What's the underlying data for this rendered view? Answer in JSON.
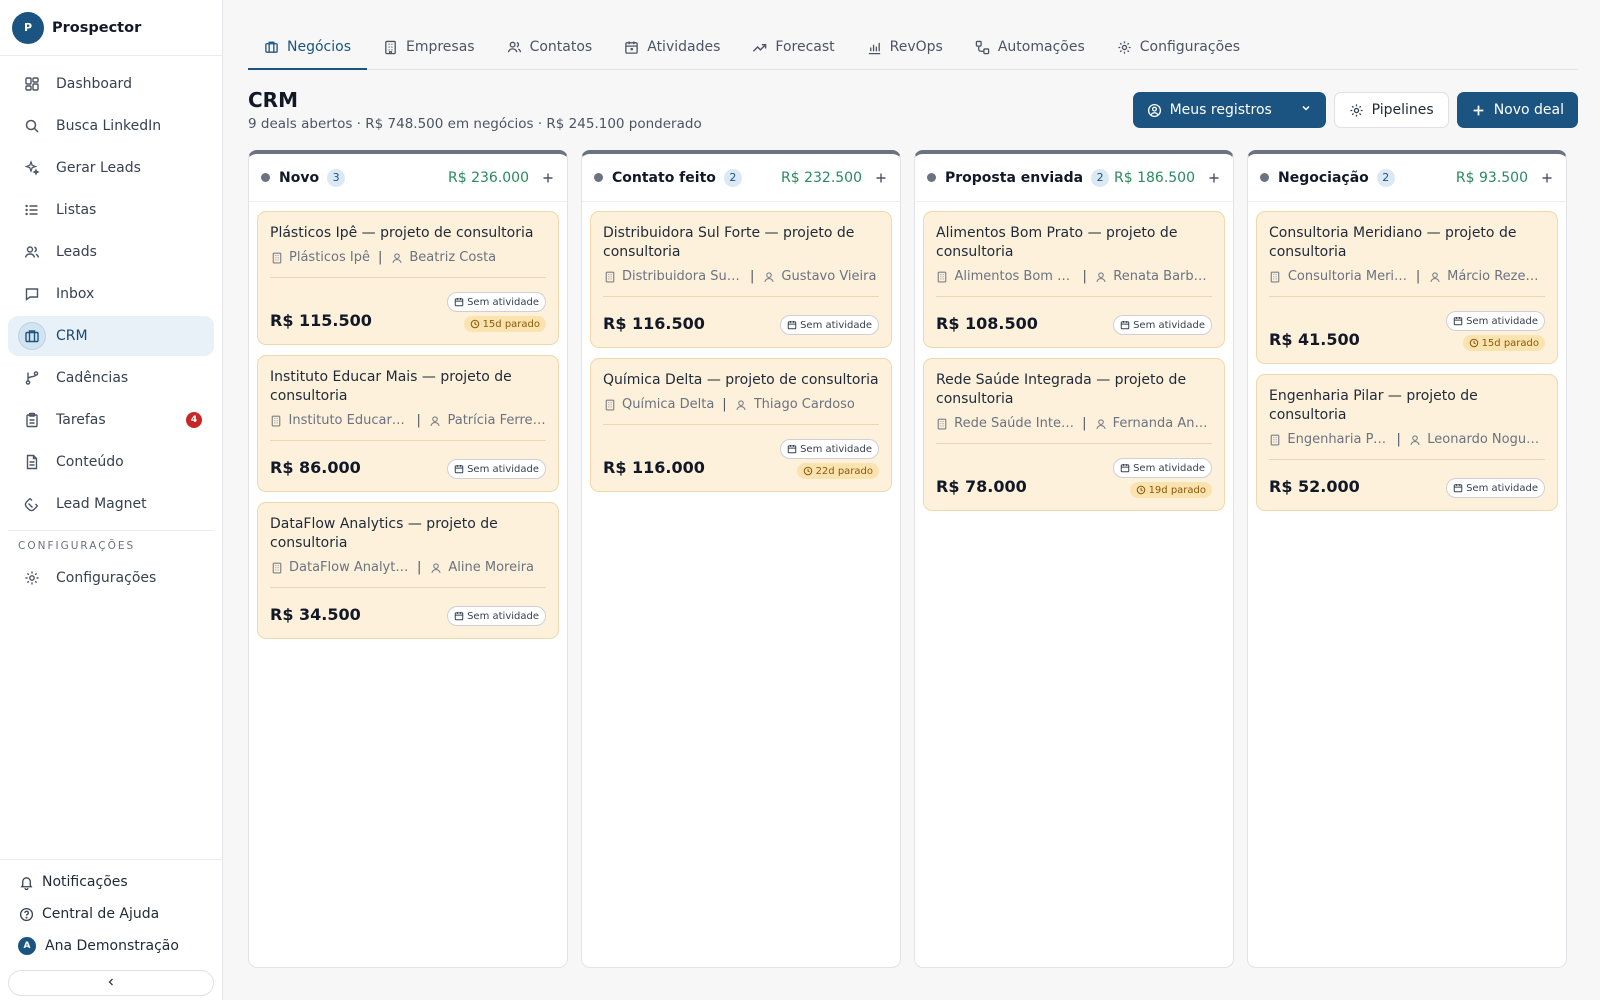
{
  "brand": {
    "logo_letter": "P",
    "name": "Prospector"
  },
  "sidebar": {
    "items": [
      {
        "label": "Dashboard",
        "icon": "dashboard-icon"
      },
      {
        "label": "Busca LinkedIn",
        "icon": "search-icon"
      },
      {
        "label": "Gerar Leads",
        "icon": "sparkles-icon"
      },
      {
        "label": "Listas",
        "icon": "list-icon"
      },
      {
        "label": "Leads",
        "icon": "users-icon"
      },
      {
        "label": "Inbox",
        "icon": "message-icon"
      },
      {
        "label": "CRM",
        "icon": "briefcase-icon",
        "active": true
      },
      {
        "label": "Cadências",
        "icon": "git-branch-icon"
      },
      {
        "label": "Tarefas",
        "icon": "clipboard-icon",
        "badge": "4"
      },
      {
        "label": "Conteúdo",
        "icon": "document-icon"
      },
      {
        "label": "Lead Magnet",
        "icon": "magnet-icon"
      }
    ],
    "section_label": "CONFIGURAÇÕES",
    "settings_label": "Configurações",
    "bottom": {
      "notifications": "Notificações",
      "help": "Central de Ajuda",
      "user_initial": "A",
      "user_name": "Ana Demonstração"
    }
  },
  "tabs": [
    {
      "label": "Negócios",
      "icon": "briefcase-icon",
      "active": true
    },
    {
      "label": "Empresas",
      "icon": "building-icon"
    },
    {
      "label": "Contatos",
      "icon": "users-icon"
    },
    {
      "label": "Atividades",
      "icon": "calendar-icon"
    },
    {
      "label": "Forecast",
      "icon": "trend-icon"
    },
    {
      "label": "RevOps",
      "icon": "bar-chart-icon"
    },
    {
      "label": "Automações",
      "icon": "workflow-icon"
    },
    {
      "label": "Configurações",
      "icon": "gear-icon"
    }
  ],
  "header": {
    "title": "CRM",
    "subtitle": "9 deals abertos · R$ 748.500 em negócios · R$ 245.100 ponderado",
    "filter_label": "Meus registros",
    "pipelines_label": "Pipelines",
    "new_deal_label": "Novo deal"
  },
  "columns": [
    {
      "name": "Novo",
      "count": "3",
      "total": "R$ 236.000",
      "cards": [
        {
          "title": "Plásticos Ipê — projeto de consultoria",
          "company": "Plásticos Ipê",
          "contact": "Beatriz Costa",
          "value": "R$ 115.500",
          "activity": "Sem atividade",
          "stale": "15d parado"
        },
        {
          "title": "Instituto Educar Mais — projeto de consultoria",
          "company": "Instituto Educar Mais",
          "contact": "Patrícia Ferreira",
          "value": "R$ 86.000",
          "activity": "Sem atividade",
          "stale": ""
        },
        {
          "title": "DataFlow Analytics — projeto de consultoria",
          "company": "DataFlow Analytics",
          "contact": "Aline Moreira",
          "value": "R$ 34.500",
          "activity": "Sem atividade",
          "stale": ""
        }
      ]
    },
    {
      "name": "Contato feito",
      "count": "2",
      "total": "R$ 232.500",
      "cards": [
        {
          "title": "Distribuidora Sul Forte — projeto de consultoria",
          "company": "Distribuidora Sul Forte",
          "contact": "Gustavo Vieira",
          "value": "R$ 116.500",
          "activity": "Sem atividade",
          "stale": ""
        },
        {
          "title": "Química Delta — projeto de consultoria",
          "company": "Química Delta",
          "contact": "Thiago Cardoso",
          "value": "R$ 116.000",
          "activity": "Sem atividade",
          "stale": "22d parado"
        }
      ]
    },
    {
      "name": "Proposta enviada",
      "count": "2",
      "total": "R$ 186.500",
      "cards": [
        {
          "title": "Alimentos Bom Prato — projeto de consultoria",
          "company": "Alimentos Bom Prato",
          "contact": "Renata Barbosa",
          "value": "R$ 108.500",
          "activity": "Sem atividade",
          "stale": ""
        },
        {
          "title": "Rede Saúde Integrada — projeto de consultoria",
          "company": "Rede Saúde Integr...",
          "contact": "Fernanda Andr...",
          "value": "R$ 78.000",
          "activity": "Sem atividade",
          "stale": "19d parado"
        }
      ]
    },
    {
      "name": "Negociação",
      "count": "2",
      "total": "R$ 93.500",
      "cards": [
        {
          "title": "Consultoria Meridiano — projeto de consultoria",
          "company": "Consultoria Meridia...",
          "contact": "Márcio Rezen...",
          "value": "R$ 41.500",
          "activity": "Sem atividade",
          "stale": "15d parado"
        },
        {
          "title": "Engenharia Pilar — projeto de consultoria",
          "company": "Engenharia Pilar",
          "contact": "Leonardo Nogueira",
          "value": "R$ 52.000",
          "activity": "Sem atividade",
          "stale": ""
        }
      ]
    }
  ],
  "colors": {
    "brand": "#1b5480",
    "card_bg": "#fdf1dc",
    "total_green": "#2a8a5c",
    "badge_red": "#c62828",
    "stale_bg": "#fbe3b0"
  }
}
